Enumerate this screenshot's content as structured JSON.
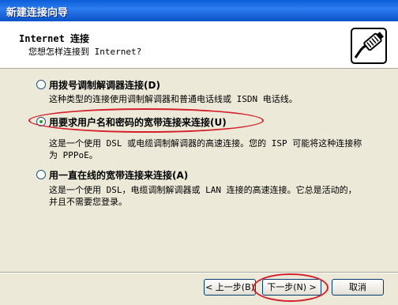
{
  "window": {
    "title": "新建连接向导"
  },
  "header": {
    "title": "Internet 连接",
    "subtitle": "您想怎样连接到 Internet?",
    "icon": "network-cable-icon"
  },
  "options": [
    {
      "label": "用拨号调制解调器连接(D)",
      "desc": "这种类型的连接使用调制解调器和普通电话线或 ISDN 电话线。",
      "checked": false
    },
    {
      "label": "用要求用户名和密码的宽带连接来连接(U)",
      "desc": "这是一个使用 DSL 或电缆调制解调器的高速连接。您的 ISP 可能将这种连接称为 PPPoE。",
      "checked": true
    },
    {
      "label": "用一直在线的宽带连接来连接(A)",
      "desc": "这是一个使用 DSL，电缆调制解调器或 LAN 连接的高速连接。它总是活动的，并且不需要您登录。",
      "checked": false
    }
  ],
  "buttons": {
    "back": "< 上一步(B)",
    "next": "下一步(N) >",
    "cancel": "取消"
  },
  "colors": {
    "titlebar": "#0a5fd8",
    "annotation": "#d4202a",
    "radio_dot": "#21a121"
  }
}
